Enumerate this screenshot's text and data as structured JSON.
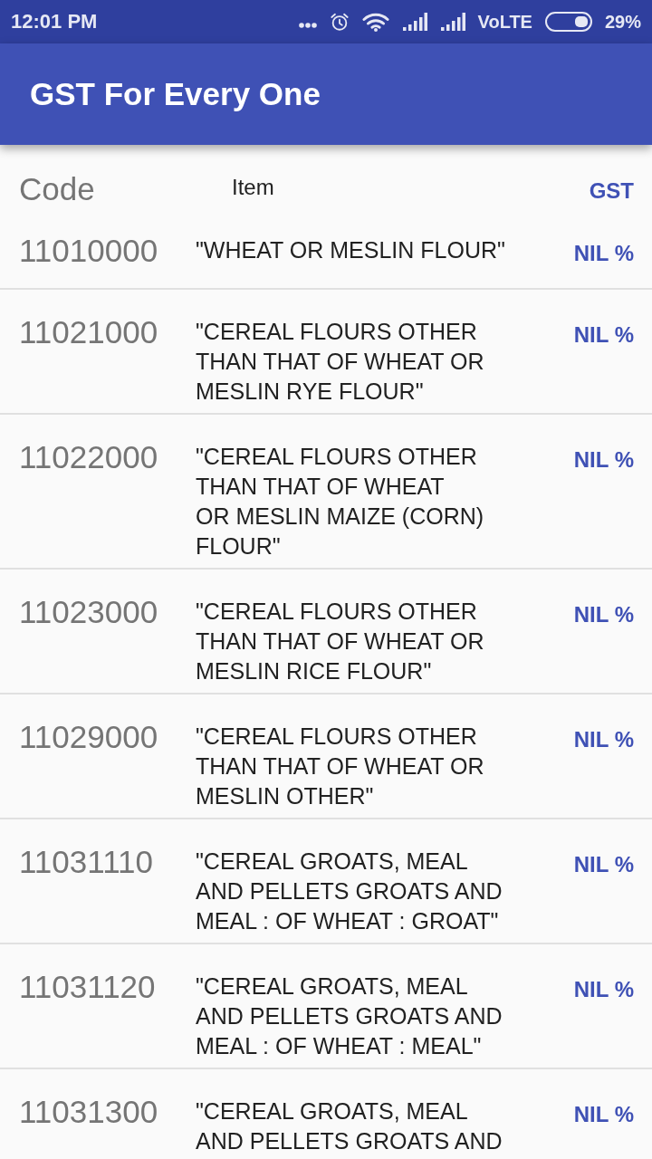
{
  "status_bar": {
    "time": "12:01 PM",
    "network": "VoLTE",
    "battery": "29%"
  },
  "app_bar": {
    "title": "GST For Every One"
  },
  "table": {
    "columns": [
      {
        "label": "Code",
        "kind": "code"
      },
      {
        "label": "Item",
        "kind": "item"
      },
      {
        "label": "GST",
        "kind": "gst"
      }
    ],
    "rows": [
      {
        "code": "11010000",
        "item": "\"WHEAT OR MESLIN FLOUR\"",
        "gst": "NIL %"
      },
      {
        "code": "11021000",
        "item": "\"CEREAL FLOURS OTHER THAN THAT OF WHEAT OR MESLIN RYE FLOUR\"",
        "gst": "NIL %"
      },
      {
        "code": "11022000",
        "item": "\"CEREAL FLOURS OTHER THAN THAT OF WHEAT\nOR MESLIN MAIZE (CORN) FLOUR\"",
        "gst": "NIL %"
      },
      {
        "code": "11023000",
        "item": "\"CEREAL FLOURS OTHER THAN THAT OF WHEAT OR MESLIN RICE FLOUR\"",
        "gst": "NIL %"
      },
      {
        "code": "11029000",
        "item": "\"CEREAL FLOURS OTHER THAN THAT OF WHEAT OR MESLIN OTHER\"",
        "gst": "NIL %"
      },
      {
        "code": "11031110",
        "item": "\"CEREAL GROATS, MEAL AND PELLETS GROATS AND MEAL : OF WHEAT : GROAT\"",
        "gst": "NIL %"
      },
      {
        "code": "11031120",
        "item": "\"CEREAL GROATS, MEAL AND PELLETS GROATS AND MEAL : OF WHEAT : MEAL\"",
        "gst": "NIL %"
      },
      {
        "code": "11031300",
        "item": "\"CEREAL GROATS, MEAL AND PELLETS GROATS AND",
        "gst": "NIL %"
      }
    ]
  }
}
